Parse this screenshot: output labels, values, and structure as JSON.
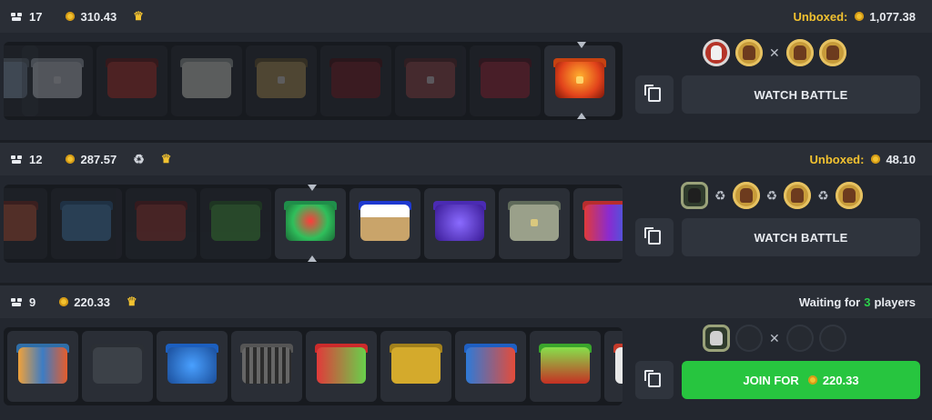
{
  "battles": [
    {
      "rounds": "17",
      "cost": "310.43",
      "status_label": "Unboxed:",
      "status_value": "1,077.38",
      "action_label": "WATCH BATTLE"
    },
    {
      "rounds": "12",
      "cost": "287.57",
      "status_label": "Unboxed:",
      "status_value": "48.10",
      "action_label": "WATCH BATTLE"
    },
    {
      "rounds": "9",
      "cost": "220.33",
      "waiting_prefix": "Waiting for",
      "waiting_count": "3",
      "waiting_suffix": "players",
      "action_label": "JOIN FOR",
      "action_value": "220.33"
    }
  ],
  "colors": {
    "accent_gold": "#f2c230",
    "join_green": "#27c53f",
    "panel": "#23272f"
  },
  "icons": [
    "box-icon",
    "coin-icon",
    "crown-icon",
    "recycle-icon",
    "copy-icon",
    "swords-icon"
  ]
}
